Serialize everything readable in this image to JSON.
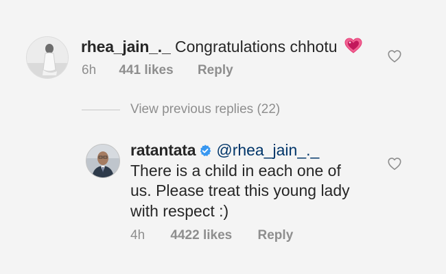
{
  "comment1": {
    "username": "rhea_jain_._",
    "text": "Congratulations chhotu",
    "emoji_icon": "sparkling-heart-icon",
    "time": "6h",
    "likes": "441 likes",
    "reply_label": "Reply"
  },
  "replies_toggle": {
    "label": "View previous replies (22)"
  },
  "comment2": {
    "username": "ratantata",
    "verified_icon": "verified-badge-icon",
    "mention": "@rhea_jain_._",
    "text_lines": [
      "There is a child in each one of",
      "us. Please treat this young lady",
      "with respect :)"
    ],
    "time": "4h",
    "likes": "4422 likes",
    "reply_label": "Reply"
  },
  "colors": {
    "background": "#f4f4f4",
    "text": "#262626",
    "meta": "#8e8e8e",
    "mention": "#003569",
    "verified": "#3897f0",
    "heart": "#d81b60"
  }
}
